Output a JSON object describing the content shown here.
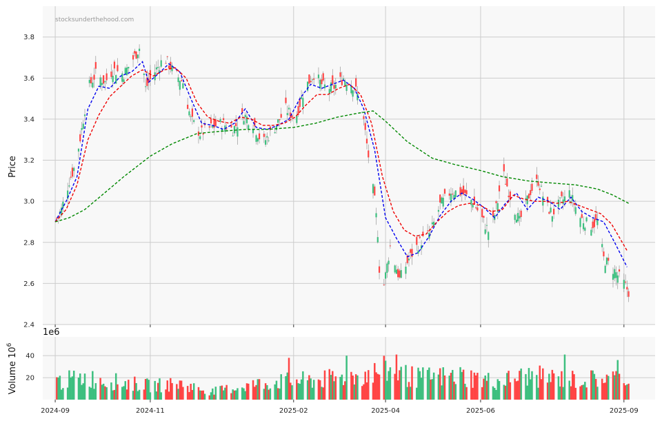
{
  "watermark": "stocksunderthehood.com",
  "colors": {
    "up": "#3dbf7f",
    "down": "#ff4444",
    "ma_short": "#0000ee",
    "ma_medium": "#ee0000",
    "ma_long": "#008800",
    "panel_bg": "#f8f8f8",
    "grid": "#cccccc"
  },
  "chart_data": [
    {
      "type": "candlestick",
      "ylabel": "Price",
      "ylim": [
        2.4,
        3.95
      ],
      "yticks": [
        "2.4",
        "2.6",
        "2.8",
        "3.0",
        "3.2",
        "3.4",
        "3.6",
        "3.8"
      ],
      "ytick_values": [
        2.4,
        2.6,
        2.8,
        3.0,
        3.2,
        3.4,
        3.6,
        3.8
      ],
      "xlim": [
        "2024-08-24",
        "2025-09-21"
      ],
      "grid": true,
      "price_anchors": [
        [
          "2024-09-01",
          2.9
        ],
        [
          "2024-09-05",
          2.96
        ],
        [
          "2024-09-10",
          3.1
        ],
        [
          "2024-09-14",
          3.18
        ],
        [
          "2024-09-18",
          3.35
        ],
        [
          "2024-09-22",
          3.55
        ],
        [
          "2024-09-27",
          3.62
        ],
        [
          "2024-10-03",
          3.58
        ],
        [
          "2024-10-08",
          3.64
        ],
        [
          "2024-10-15",
          3.62
        ],
        [
          "2024-10-20",
          3.68
        ],
        [
          "2024-10-26",
          3.76
        ],
        [
          "2024-10-29",
          3.55
        ],
        [
          "2024-11-03",
          3.62
        ],
        [
          "2024-11-10",
          3.7
        ],
        [
          "2024-11-17",
          3.62
        ],
        [
          "2024-11-22",
          3.58
        ],
        [
          "2024-11-27",
          3.4
        ],
        [
          "2024-12-03",
          3.33
        ],
        [
          "2024-12-10",
          3.36
        ],
        [
          "2024-12-17",
          3.38
        ],
        [
          "2024-12-24",
          3.35
        ],
        [
          "2024-12-31",
          3.42
        ],
        [
          "2025-01-06",
          3.38
        ],
        [
          "2025-01-12",
          3.28
        ],
        [
          "2025-01-20",
          3.36
        ],
        [
          "2025-01-27",
          3.45
        ],
        [
          "2025-02-02",
          3.4
        ],
        [
          "2025-02-08",
          3.55
        ],
        [
          "2025-02-14",
          3.62
        ],
        [
          "2025-02-20",
          3.56
        ],
        [
          "2025-02-26",
          3.55
        ],
        [
          "2025-03-05",
          3.6
        ],
        [
          "2025-03-12",
          3.56
        ],
        [
          "2025-03-17",
          3.45
        ],
        [
          "2025-03-21",
          3.22
        ],
        [
          "2025-03-25",
          3.0
        ],
        [
          "2025-03-27",
          2.85
        ],
        [
          "2025-03-29",
          2.5
        ],
        [
          "2025-04-04",
          2.78
        ],
        [
          "2025-04-10",
          2.62
        ],
        [
          "2025-04-16",
          2.72
        ],
        [
          "2025-04-23",
          2.8
        ],
        [
          "2025-04-30",
          2.85
        ],
        [
          "2025-05-06",
          2.98
        ],
        [
          "2025-05-13",
          3.05
        ],
        [
          "2025-05-20",
          3.04
        ],
        [
          "2025-05-27",
          3.0
        ],
        [
          "2025-06-03",
          2.9
        ],
        [
          "2025-06-07",
          2.84
        ],
        [
          "2025-06-12",
          3.0
        ],
        [
          "2025-06-15",
          3.15
        ],
        [
          "2025-06-21",
          3.0
        ],
        [
          "2025-06-26",
          2.9
        ],
        [
          "2025-07-03",
          3.05
        ],
        [
          "2025-07-08",
          3.1
        ],
        [
          "2025-07-13",
          2.98
        ],
        [
          "2025-07-17",
          2.94
        ],
        [
          "2025-07-23",
          3.0
        ],
        [
          "2025-07-28",
          3.04
        ],
        [
          "2025-08-04",
          2.92
        ],
        [
          "2025-08-10",
          2.88
        ],
        [
          "2025-08-15",
          2.9
        ],
        [
          "2025-08-19",
          2.72
        ],
        [
          "2025-08-26",
          2.66
        ],
        [
          "2025-09-01",
          2.6
        ],
        [
          "2025-09-04",
          2.56
        ]
      ],
      "ma_short": [
        [
          "2024-09-01",
          2.9
        ],
        [
          "2024-09-08",
          3.0
        ],
        [
          "2024-09-15",
          3.12
        ],
        [
          "2024-09-22",
          3.45
        ],
        [
          "2024-09-29",
          3.56
        ],
        [
          "2024-10-06",
          3.55
        ],
        [
          "2024-10-13",
          3.61
        ],
        [
          "2024-10-20",
          3.63
        ],
        [
          "2024-10-27",
          3.68
        ],
        [
          "2024-10-31",
          3.58
        ],
        [
          "2024-11-06",
          3.62
        ],
        [
          "2024-11-13",
          3.67
        ],
        [
          "2024-11-20",
          3.63
        ],
        [
          "2024-11-27",
          3.5
        ],
        [
          "2024-12-04",
          3.38
        ],
        [
          "2024-12-11",
          3.37
        ],
        [
          "2024-12-18",
          3.35
        ],
        [
          "2024-12-25",
          3.38
        ],
        [
          "2025-01-01",
          3.45
        ],
        [
          "2025-01-08",
          3.36
        ],
        [
          "2025-01-15",
          3.35
        ],
        [
          "2025-01-22",
          3.37
        ],
        [
          "2025-01-29",
          3.4
        ],
        [
          "2025-02-05",
          3.5
        ],
        [
          "2025-02-12",
          3.57
        ],
        [
          "2025-02-19",
          3.55
        ],
        [
          "2025-02-26",
          3.57
        ],
        [
          "2025-03-05",
          3.59
        ],
        [
          "2025-03-12",
          3.55
        ],
        [
          "2025-03-18",
          3.45
        ],
        [
          "2025-03-25",
          3.25
        ],
        [
          "2025-04-01",
          2.92
        ],
        [
          "2025-04-08",
          2.82
        ],
        [
          "2025-04-15",
          2.73
        ],
        [
          "2025-04-22",
          2.75
        ],
        [
          "2025-04-29",
          2.83
        ],
        [
          "2025-05-06",
          2.93
        ],
        [
          "2025-05-13",
          3.0
        ],
        [
          "2025-05-20",
          3.04
        ],
        [
          "2025-05-27",
          3.01
        ],
        [
          "2025-06-03",
          2.97
        ],
        [
          "2025-06-10",
          2.92
        ],
        [
          "2025-06-17",
          2.99
        ],
        [
          "2025-06-24",
          3.04
        ],
        [
          "2025-07-01",
          2.96
        ],
        [
          "2025-07-08",
          3.02
        ],
        [
          "2025-07-15",
          3.0
        ],
        [
          "2025-07-22",
          2.96
        ],
        [
          "2025-07-29",
          3.02
        ],
        [
          "2025-08-05",
          2.95
        ],
        [
          "2025-08-12",
          2.92
        ],
        [
          "2025-08-19",
          2.9
        ],
        [
          "2025-08-26",
          2.8
        ],
        [
          "2025-09-03",
          2.68
        ]
      ],
      "ma_medium": [
        [
          "2024-09-01",
          2.9
        ],
        [
          "2024-09-08",
          2.96
        ],
        [
          "2024-09-15",
          3.08
        ],
        [
          "2024-09-22",
          3.3
        ],
        [
          "2024-09-29",
          3.42
        ],
        [
          "2024-10-06",
          3.51
        ],
        [
          "2024-10-13",
          3.56
        ],
        [
          "2024-10-20",
          3.61
        ],
        [
          "2024-10-27",
          3.64
        ],
        [
          "2024-11-03",
          3.61
        ],
        [
          "2024-11-10",
          3.64
        ],
        [
          "2024-11-17",
          3.65
        ],
        [
          "2024-11-24",
          3.6
        ],
        [
          "2024-12-01",
          3.48
        ],
        [
          "2024-12-08",
          3.41
        ],
        [
          "2024-12-15",
          3.39
        ],
        [
          "2024-12-22",
          3.38
        ],
        [
          "2024-12-29",
          3.41
        ],
        [
          "2025-01-05",
          3.4
        ],
        [
          "2025-01-12",
          3.37
        ],
        [
          "2025-01-19",
          3.37
        ],
        [
          "2025-01-26",
          3.38
        ],
        [
          "2025-02-02",
          3.41
        ],
        [
          "2025-02-09",
          3.47
        ],
        [
          "2025-02-16",
          3.52
        ],
        [
          "2025-02-23",
          3.52
        ],
        [
          "2025-03-02",
          3.55
        ],
        [
          "2025-03-09",
          3.57
        ],
        [
          "2025-03-16",
          3.52
        ],
        [
          "2025-03-23",
          3.38
        ],
        [
          "2025-03-30",
          3.12
        ],
        [
          "2025-04-06",
          2.95
        ],
        [
          "2025-04-13",
          2.86
        ],
        [
          "2025-04-20",
          2.83
        ],
        [
          "2025-04-27",
          2.84
        ],
        [
          "2025-05-04",
          2.9
        ],
        [
          "2025-05-11",
          2.95
        ],
        [
          "2025-05-18",
          2.98
        ],
        [
          "2025-05-25",
          2.99
        ],
        [
          "2025-06-01",
          2.98
        ],
        [
          "2025-06-08",
          2.95
        ],
        [
          "2025-06-15",
          2.96
        ],
        [
          "2025-06-22",
          3.03
        ],
        [
          "2025-06-29",
          3.01
        ],
        [
          "2025-07-06",
          3.0
        ],
        [
          "2025-07-13",
          3.0
        ],
        [
          "2025-07-20",
          2.99
        ],
        [
          "2025-07-27",
          3.0
        ],
        [
          "2025-08-03",
          2.98
        ],
        [
          "2025-08-10",
          2.96
        ],
        [
          "2025-08-17",
          2.94
        ],
        [
          "2025-08-24",
          2.89
        ],
        [
          "2025-09-03",
          2.76
        ]
      ],
      "ma_long": [
        [
          "2024-09-01",
          2.9
        ],
        [
          "2024-09-10",
          2.92
        ],
        [
          "2024-09-20",
          2.96
        ],
        [
          "2024-10-01",
          3.03
        ],
        [
          "2024-10-15",
          3.12
        ],
        [
          "2024-11-01",
          3.22
        ],
        [
          "2024-11-15",
          3.28
        ],
        [
          "2024-12-01",
          3.33
        ],
        [
          "2024-12-15",
          3.34
        ],
        [
          "2025-01-01",
          3.35
        ],
        [
          "2025-01-15",
          3.35
        ],
        [
          "2025-02-01",
          3.36
        ],
        [
          "2025-02-15",
          3.38
        ],
        [
          "2025-03-01",
          3.41
        ],
        [
          "2025-03-15",
          3.43
        ],
        [
          "2025-03-24",
          3.44
        ],
        [
          "2025-04-01",
          3.39
        ],
        [
          "2025-04-15",
          3.29
        ],
        [
          "2025-05-01",
          3.21
        ],
        [
          "2025-05-15",
          3.18
        ],
        [
          "2025-06-01",
          3.15
        ],
        [
          "2025-06-15",
          3.12
        ],
        [
          "2025-07-01",
          3.1
        ],
        [
          "2025-07-15",
          3.09
        ],
        [
          "2025-08-01",
          3.08
        ],
        [
          "2025-08-15",
          3.06
        ],
        [
          "2025-08-25",
          3.03
        ],
        [
          "2025-09-04",
          2.99
        ]
      ]
    },
    {
      "type": "bar",
      "ylabel": "Volume  10",
      "ylabel_exponent": "6",
      "offset_text": "1e6",
      "ylim": [
        0,
        57
      ],
      "yticks": [
        "20",
        "40"
      ],
      "ytick_values": [
        20,
        40
      ],
      "grid": true,
      "volume_anchors": [
        [
          "2024-09-01",
          18
        ],
        [
          "2024-09-20",
          22
        ],
        [
          "2024-10-10",
          18
        ],
        [
          "2024-11-01",
          14
        ],
        [
          "2024-11-20",
          16
        ],
        [
          "2024-12-10",
          8
        ],
        [
          "2025-01-01",
          14
        ],
        [
          "2025-01-20",
          18
        ],
        [
          "2025-02-20",
          20
        ],
        [
          "2025-03-15",
          24
        ],
        [
          "2025-04-01",
          30
        ],
        [
          "2025-04-20",
          22
        ],
        [
          "2025-05-20",
          24
        ],
        [
          "2025-06-10",
          18
        ],
        [
          "2025-07-01",
          24
        ],
        [
          "2025-08-01",
          20
        ],
        [
          "2025-09-04",
          22
        ]
      ],
      "volume_spikes": [
        [
          "2025-01-29",
          38
        ],
        [
          "2025-03-07",
          40
        ],
        [
          "2025-04-08",
          41
        ],
        [
          "2025-05-17",
          52
        ],
        [
          "2025-07-25",
          41
        ],
        [
          "2025-08-28",
          36
        ]
      ]
    }
  ],
  "x_axis": {
    "ticks": [
      {
        "date": "2024-09-01",
        "label": "2024-09"
      },
      {
        "date": "2024-11-01",
        "label": "2024-11"
      },
      {
        "date": "2025-02-01",
        "label": "2025-02"
      },
      {
        "date": "2025-04-01",
        "label": "2025-04"
      },
      {
        "date": "2025-06-01",
        "label": "2025-06"
      },
      {
        "date": "2025-09-01",
        "label": "2025-09"
      }
    ]
  }
}
